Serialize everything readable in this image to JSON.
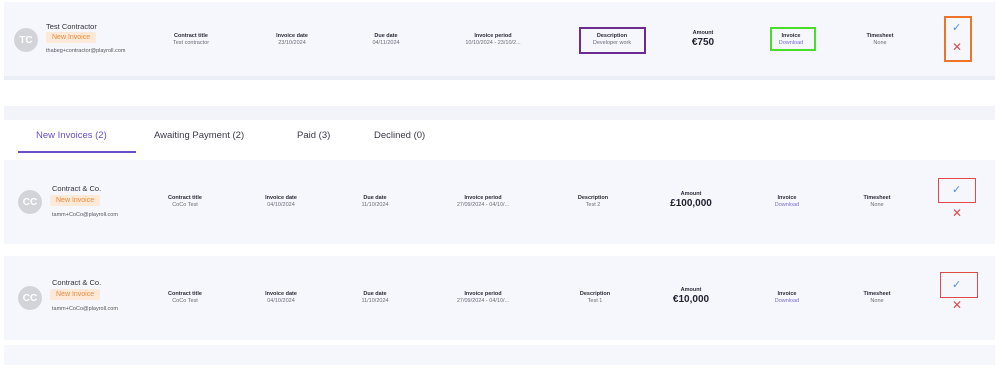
{
  "top_row": {
    "avatar": "TC",
    "name": "Test Contractor",
    "badge": "New Invoice",
    "email": "thabeg+contractor@playroll.com",
    "contract_title_label": "Contract title",
    "contract_title": "Test contractor",
    "invoice_date_label": "Invoice date",
    "invoice_date": "23/10/2024",
    "due_date_label": "Due date",
    "due_date": "04/11/2024",
    "invoice_period_label": "Invoice period",
    "invoice_period": "10/10/2024 - 23/10/2...",
    "description_label": "Description",
    "description": "Developer work",
    "amount_label": "Amount",
    "amount": "€750",
    "invoice_label": "Invoice",
    "invoice_link": "Download",
    "timesheet_label": "Timesheet",
    "timesheet": "None",
    "highlight_colors": {
      "description": "#6b2b8f",
      "invoice": "#4ade2a",
      "actions": "#f07428"
    }
  },
  "tabs": [
    {
      "label": "New Invoices (2)"
    },
    {
      "label": "Awaiting Payment (2)"
    },
    {
      "label": "Paid (3)"
    },
    {
      "label": "Declined (0)"
    }
  ],
  "rows": [
    {
      "avatar": "CC",
      "name": "Contract & Co.",
      "badge": "New Invoice",
      "email": "tamm+CoCo@playroll.com",
      "contract_title_label": "Contract title",
      "contract_title": "CoCo Test",
      "invoice_date_label": "Invoice date",
      "invoice_date": "04/10/2024",
      "due_date_label": "Due date",
      "due_date": "11/10/2024",
      "invoice_period_label": "Invoice period",
      "invoice_period": "27/09/2024 - 04/10/...",
      "description_label": "Description",
      "description": "Test 2",
      "amount_label": "Amount",
      "amount": "£100,000",
      "invoice_label": "Invoice",
      "invoice_link": "Download",
      "timesheet_label": "Timesheet",
      "timesheet": "None"
    },
    {
      "avatar": "CC",
      "name": "Contract & Co.",
      "badge": "New Invoice",
      "email": "tamm+CoCo@playroll.com",
      "contract_title_label": "Contract title",
      "contract_title": "CoCo Test",
      "invoice_date_label": "Invoice date",
      "invoice_date": "04/10/2024",
      "due_date_label": "Due date",
      "due_date": "11/10/2024",
      "invoice_period_label": "Invoice period",
      "invoice_period": "27/09/2024 - 04/10/...",
      "description_label": "Description",
      "description": "Test 1",
      "amount_label": "Amount",
      "amount": "€10,000",
      "invoice_label": "Invoice",
      "invoice_link": "Download",
      "timesheet_label": "Timesheet",
      "timesheet": "None"
    }
  ],
  "icons": {
    "approve": "check-icon",
    "decline": "close-icon",
    "action_box_color": "#e04a4a"
  }
}
